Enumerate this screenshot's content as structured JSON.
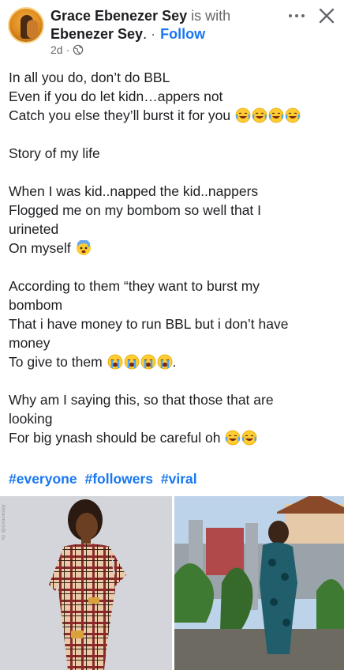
{
  "author": {
    "name": "Grace Ebenezer Sey",
    "with_text": "is with",
    "tagged": "Ebenezer Sey",
    "follow_label": "Follow",
    "time": "2d",
    "separator": "·",
    "tag_sep": "."
  },
  "actions": {
    "more_icon": "more-dots-icon",
    "close_icon": "close-icon"
  },
  "post": {
    "lines": [
      "In all you do, don’t do BBL",
      "Even if you do let kidn…appers not",
      "Catch you else they’ll burst it for you",
      "Story of my life",
      "When I was kid..napped  the kid..nappers",
      "Flogged me on my bombom so well that I",
      "urineted",
      "On myself",
      "According to them “they want to burst my",
      "bombom",
      "That i have money to run BBL but i don’t have",
      "money",
      "To give to them",
      ".",
      "Why am I saying this, so that those that are",
      "looking",
      "For big ynash should be careful oh"
    ],
    "emoji": {
      "laughing": "face-with-tears-of-joy-icon",
      "fearful": "anxious-face-with-sweat-icon",
      "crying": "loudly-crying-face-icon"
    }
  },
  "hashtags": [
    "#everyone",
    "#followers",
    "#viral"
  ],
  "photos": {
    "left_watermark": "IG @Gracesey",
    "left_alt": "woman-in-plaid-dress-photo",
    "right_alt": "woman-in-garden-photo"
  },
  "colors": {
    "link": "#1877f2",
    "muted": "#65676b",
    "text": "#1c1e21"
  }
}
